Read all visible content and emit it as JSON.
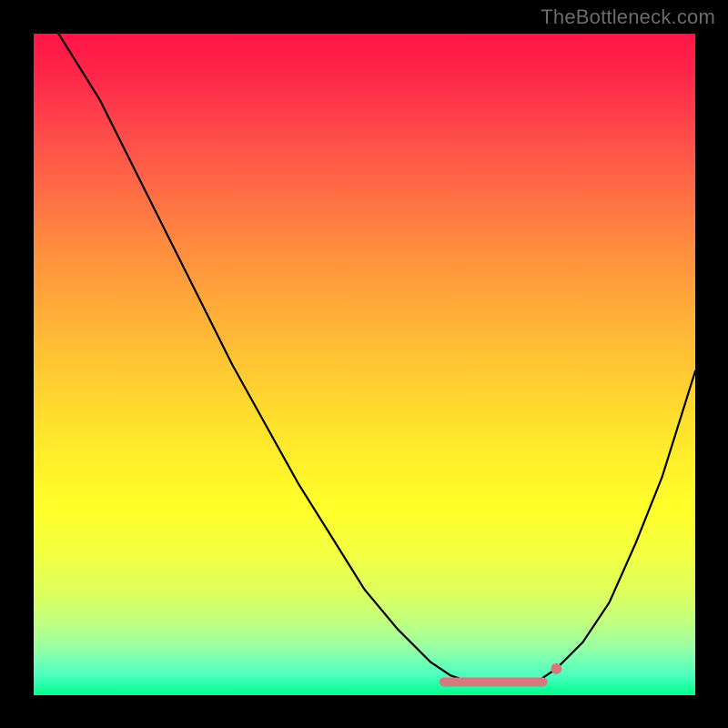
{
  "watermark": "TheBottleneck.com",
  "chart_data": {
    "type": "line",
    "title": "",
    "xlabel": "",
    "ylabel": "",
    "xlim": [
      0,
      100
    ],
    "ylim": [
      0,
      100
    ],
    "grid": false,
    "legend": false,
    "series": [
      {
        "name": "curve",
        "color": "#000000",
        "x": [
          0,
          5,
          10,
          15,
          20,
          25,
          30,
          35,
          40,
          45,
          50,
          55,
          60,
          63,
          66,
          70,
          73,
          76,
          79,
          83,
          87,
          91,
          95,
          100
        ],
        "values": [
          106,
          98,
          90,
          80,
          70,
          60,
          50,
          41,
          32,
          24,
          16,
          10,
          5,
          3,
          2,
          1.5,
          1.5,
          2,
          4,
          8,
          14,
          23,
          33,
          49
        ]
      }
    ],
    "annotations": [
      {
        "name": "flat-region-marker",
        "type": "segment",
        "color": "#d47a7e",
        "width": 10,
        "x0": 62,
        "y0": 2,
        "x1": 77,
        "y1": 2
      },
      {
        "name": "marker-dot",
        "type": "point",
        "color": "#d47a7e",
        "radius": 6,
        "x": 79,
        "y": 4
      }
    ],
    "background_gradient": {
      "direction": "vertical",
      "stops": [
        {
          "pos": 0.0,
          "color": "#ff1447"
        },
        {
          "pos": 0.5,
          "color": "#ffd82e"
        },
        {
          "pos": 0.85,
          "color": "#e0ff5a"
        },
        {
          "pos": 1.0,
          "color": "#00ff8a"
        }
      ]
    }
  }
}
